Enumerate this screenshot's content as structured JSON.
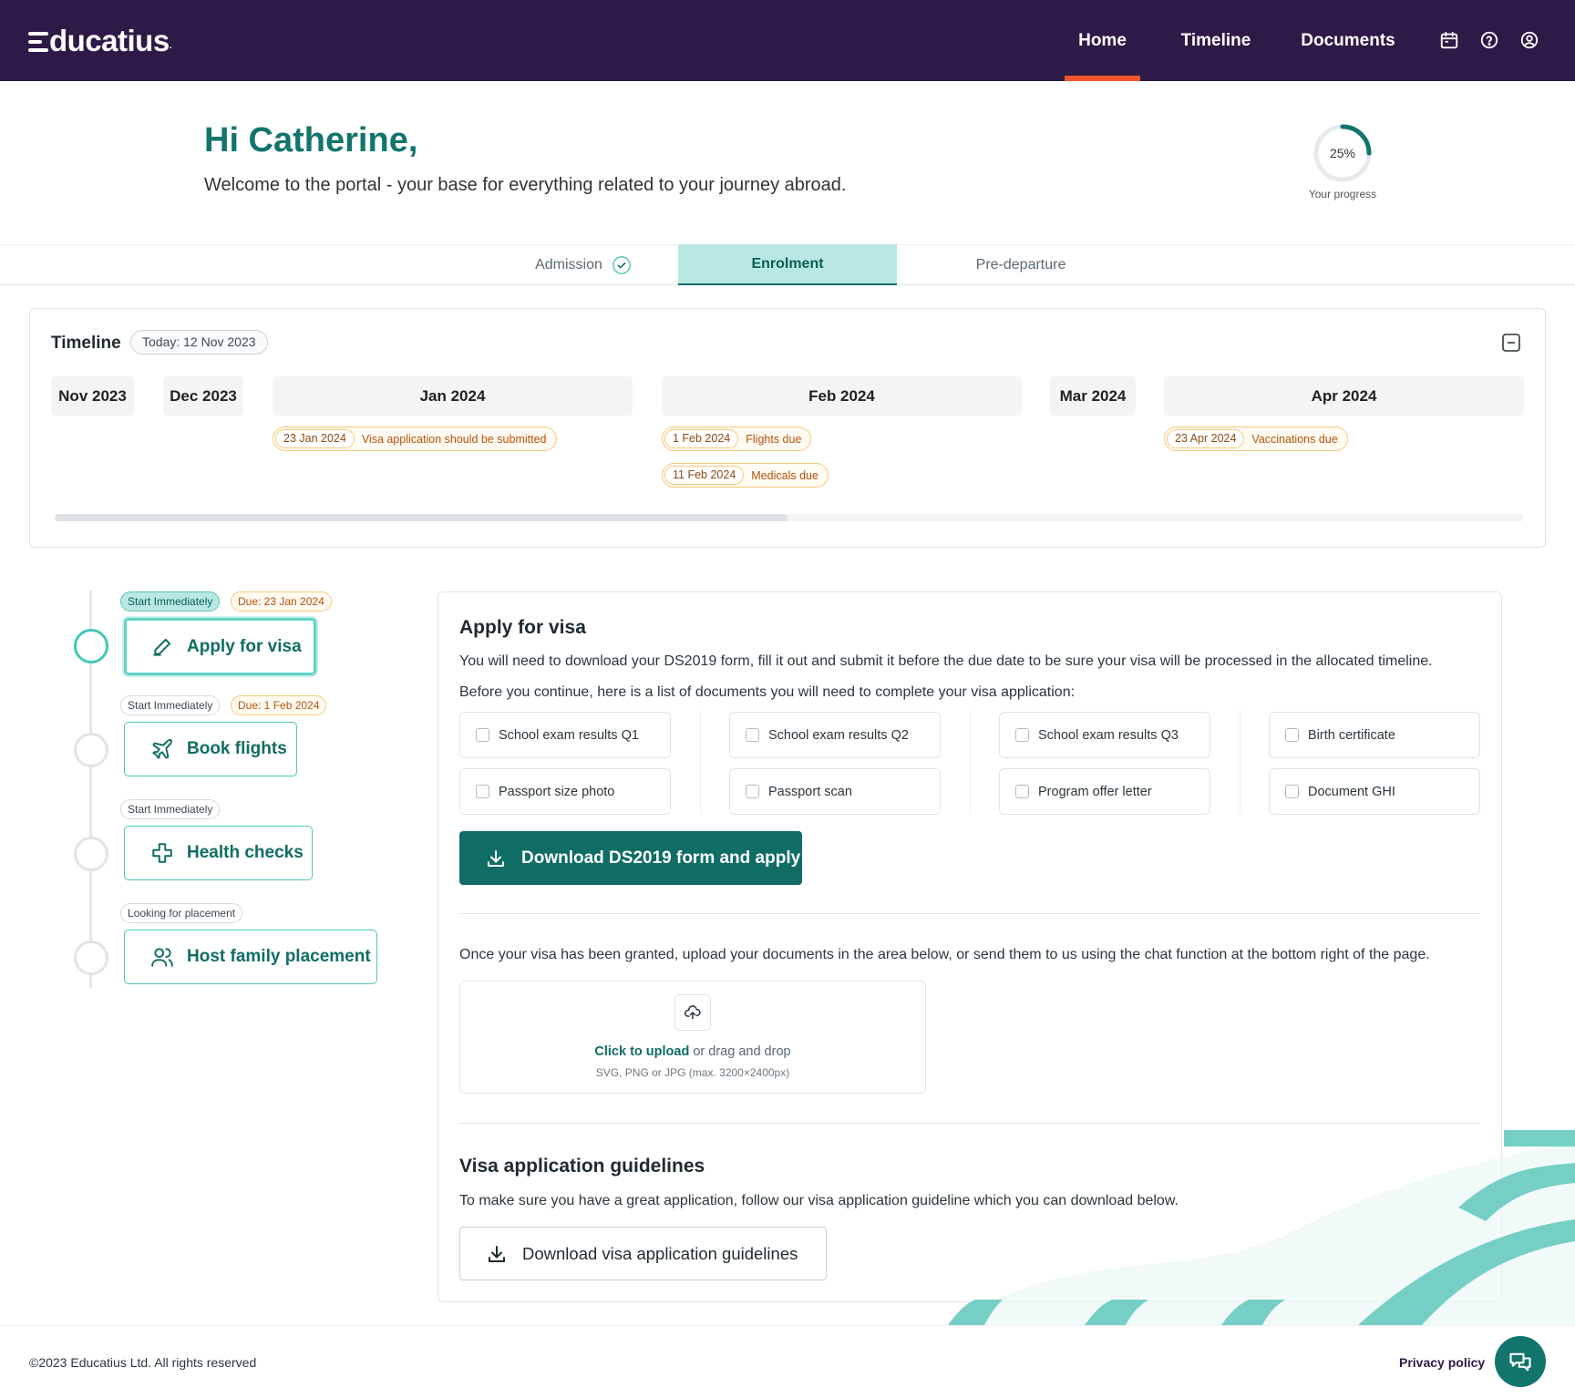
{
  "app": {
    "logo_text": "ducatius",
    "logo_dot": "."
  },
  "nav": {
    "home": "Home",
    "timeline": "Timeline",
    "documents": "Documents"
  },
  "header_icons": [
    "calendar-icon",
    "help-icon",
    "user-icon"
  ],
  "greeting": {
    "title": "Hi Catherine,",
    "subtitle": "Welcome to the portal - your base for everything related to your journey abroad."
  },
  "progress": {
    "value": 25,
    "label_value": "25%",
    "label": "Your progress"
  },
  "stages": {
    "admission": "Admission",
    "enrolment": "Enrolment",
    "predeparture": "Pre-departure"
  },
  "timeline": {
    "title": "Timeline",
    "today": "Today: 12 Nov 2023",
    "months": [
      "Nov 2023",
      "Dec 2023",
      "Jan 2024",
      "Feb 2024",
      "Mar 2024",
      "Apr 2024"
    ],
    "events": [
      {
        "date": "23 Jan 2024",
        "label": "Visa application should be submitted"
      },
      {
        "date": "1 Feb 2024",
        "label": "Flights due"
      },
      {
        "date": "11 Feb 2024",
        "label": "Medicals due"
      },
      {
        "date": "23 Apr 2024",
        "label": "Vaccinations due"
      }
    ]
  },
  "steps": [
    {
      "status": "Start Immediately",
      "due": "Due: 23 Jan 2024",
      "label": "Apply for visa"
    },
    {
      "status": "Start Immediately",
      "due": "Due: 1 Feb 2024",
      "label": "Book flights"
    },
    {
      "status": "Start Immediately",
      "label": "Health checks"
    },
    {
      "status": "Looking for placement",
      "label": "Host family placement"
    }
  ],
  "visa": {
    "title": "Apply for visa",
    "intro": "You will need to download your DS2019 form, fill it out and submit it before the due date to be sure your visa will be processed in the allocated timeline.",
    "docs_intro": "Before you continue, here is a list of documents you will need to complete your visa application:",
    "documents": [
      "School exam results Q1",
      "School exam results Q2",
      "School exam results Q3",
      "Birth certificate",
      "Passport size photo",
      "Passport scan",
      "Program offer letter",
      "Document GHI"
    ],
    "download_button": "Download DS2019 form and apply",
    "upload_intro": "Once your visa has been granted, upload your documents in the area below, or send them to us using the chat function at the bottom right of the page.",
    "upload_link": "Click to upload",
    "upload_rest": " or drag and drop",
    "upload_hint": "SVG, PNG or JPG (max. 3200×2400px)",
    "guidelines_title": "Visa application guidelines",
    "guidelines_text": "To make sure you have a great application, follow our visa application guideline which you can download below.",
    "guidelines_button": "Download visa application guidelines"
  },
  "footer": {
    "copyright": "©2023 Educatius Ltd. All rights reserved",
    "privacy": "Privacy policy"
  },
  "colors": {
    "header_bg": "#2e1a47",
    "primary": "#0f6d65",
    "accent": "#f0562a",
    "highlight": "#b9e8e3",
    "warning": "#f5c97b"
  }
}
